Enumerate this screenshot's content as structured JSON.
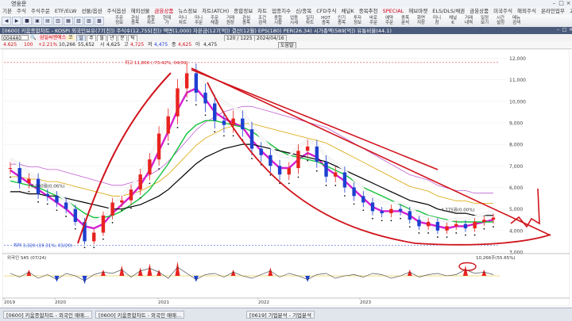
{
  "app": {
    "title": "영웅문"
  },
  "menubar": [
    "기본",
    "주식",
    "주식주문",
    "ETF/ELW",
    "선물/옵션",
    "주식옵션",
    "해외선물",
    "금융상품",
    "뉴스정보",
    "차트(ATCH)",
    "종합정보",
    "차트",
    "업종지수",
    "신/종목",
    "CFD주식",
    "채널K",
    "종목추천",
    "SPECIAL",
    "헤브마켓",
    "ELS/DLS/채권",
    "금융상품",
    "미국주식",
    "해외주식",
    "온라인업무",
    "고객서비스",
    "보기"
  ],
  "menubar_highlight": [
    7,
    17
  ],
  "toolbar": {
    "left_buttons": [
      "◀",
      "▶",
      "■",
      "▣",
      "▤",
      "▥",
      "▦",
      "▧",
      "▨",
      "▩"
    ],
    "tools": [
      {
        "l1": "주문",
        "l2": "정보"
      },
      {
        "l1": "관심",
        "l2": "종목"
      },
      {
        "l1": "종합",
        "l2": "차트"
      },
      {
        "l1": "현재",
        "l2": "가"
      },
      {
        "l1": "미니",
        "l2": "차트"
      },
      {
        "l1": "미니",
        "l2": "주문"
      },
      {
        "l1": "주문",
        "l2": "체결"
      },
      {
        "l1": "거래",
        "l2": "원장"
      },
      {
        "l1": "관심",
        "l2": "종목"
      },
      {
        "l1": "조건",
        "l2": "검색"
      },
      {
        "l1": "종합",
        "l2": "시황"
      },
      {
        "l1": "업종",
        "l2": "시세"
      },
      {
        "l1": "일지",
        "l2": "차트"
      },
      {
        "l1": "HOT",
        "l2": "종목"
      },
      {
        "l1": "인기",
        "l2": "종목"
      },
      {
        "l1": "투자",
        "l2": "정보"
      },
      {
        "l1": "바로",
        "l2": "주문"
      },
      {
        "l1": "예약",
        "l2": "주문"
      },
      {
        "l1": "종목",
        "l2": "분석"
      },
      {
        "l1": "화면",
        "l2": "저장"
      },
      {
        "l1": "미니",
        "l2": "창"
      },
      {
        "l1": "채널",
        "l2": "K"
      },
      {
        "l1": "거래",
        "l2": "내역"
      },
      {
        "l1": "일정",
        "l2": "보기"
      },
      {
        "l1": "시간",
        "l2": "설정"
      },
      {
        "l1": "메뉴",
        "l2": "검색"
      }
    ]
  },
  "window_tab": {
    "title": "[0600] 키움종합차트 - KOSPI 외국인보유(77[천]) 주식수(12,755[천]) 액면(1,000) 자본금(127[억]) 결산(12월) EPS(180) PER(26.34) 시가총액(589[억]) 유통비율(44.1)"
  },
  "search": {
    "code": "004440",
    "name": "삼일씨엔에스",
    "kospi_badge": "코",
    "period_buttons": [
      "일",
      "주",
      "월",
      "년",
      "분",
      "틱"
    ],
    "range": "120 / 1225",
    "date": "2024/04/16"
  },
  "price_row": {
    "price": "4.625",
    "change_label": "100",
    "change_pct": "+2.21%",
    "volume_k": "10,266",
    "amount": "55,652",
    "open_lbl": "시",
    "open": "4,625",
    "high_lbl": "고",
    "high": "4,725",
    "low_lbl": "저",
    "low": "4,475",
    "close_lbl": "종",
    "close": "4,625",
    "flag": "아",
    "ma": "4,475",
    "menu": "도움말"
  },
  "chart_data": {
    "type": "candlestick",
    "x_years": [
      "2019",
      "2020",
      "2021",
      "2022",
      "2023"
    ],
    "y_range": [
      3320,
      11800
    ],
    "price_annotations": {
      "high": "최고 11,800 (-73.42%, 04/09)",
      "low": "최저 3,320 (19.31%, 03/20)",
      "mid_left": "6,080원(0.06%)",
      "mid_right": "4,775원(0.00%)"
    },
    "right_labels": [
      "12,000",
      "11,000",
      "10,000",
      "9,000",
      "8,000",
      "7,000",
      "6,000",
      "5,000",
      "4,000",
      "3,000"
    ],
    "series": [
      {
        "name": "close",
        "values": [
          6.9,
          6.2,
          6.4,
          5.7,
          5.6,
          5.3,
          5.0,
          4.4,
          3.5,
          3.9,
          4.7,
          5.3,
          5.4,
          5.9,
          6.6,
          7.3,
          8.5,
          9.3,
          10.6,
          11.3,
          10.4,
          9.9,
          9.1,
          8.9,
          9.2,
          8.7,
          7.8,
          7.5,
          7.0,
          6.6,
          6.9,
          7.7,
          7.9,
          7.2,
          6.5,
          6.7,
          6.0,
          5.6,
          5.3,
          4.9,
          4.8,
          5.0,
          4.9,
          4.5,
          4.2,
          4.4,
          4.0,
          4.2,
          4.3,
          4.1,
          4.4,
          4.5,
          4.6
        ]
      },
      {
        "name": "ma5",
        "values": [
          6.8,
          6.5,
          6.2,
          5.9,
          5.6,
          5.3,
          5.0,
          4.6,
          4.2,
          4.1,
          4.3,
          4.8,
          5.2,
          5.6,
          6.1,
          6.8,
          7.7,
          8.6,
          9.6,
          10.4,
          10.6,
          10.1,
          9.5,
          9.2,
          9.0,
          8.8,
          8.2,
          7.7,
          7.3,
          6.9,
          6.9,
          7.3,
          7.6,
          7.4,
          6.9,
          6.6,
          6.3,
          5.9,
          5.5,
          5.1,
          4.9,
          4.9,
          4.9,
          4.7,
          4.4,
          4.3,
          4.2,
          4.1,
          4.2,
          4.2,
          4.3,
          4.4,
          4.5
        ]
      },
      {
        "name": "ma20",
        "values": [
          6.3,
          6.2,
          6.1,
          6.0,
          5.8,
          5.6,
          5.4,
          5.1,
          4.8,
          4.6,
          4.6,
          4.7,
          4.9,
          5.2,
          5.5,
          5.9,
          6.5,
          7.1,
          7.8,
          8.5,
          8.9,
          9.1,
          9.1,
          9.0,
          8.9,
          8.8,
          8.6,
          8.3,
          8.0,
          7.7,
          7.5,
          7.4,
          7.3,
          7.2,
          7.0,
          6.8,
          6.6,
          6.3,
          6.0,
          5.8,
          5.6,
          5.4,
          5.2,
          5.0,
          4.9,
          4.7,
          4.6,
          4.5,
          4.4,
          4.4,
          4.4,
          4.4,
          4.4
        ]
      },
      {
        "name": "ma120",
        "values": [
          5.8,
          5.8,
          5.7,
          5.7,
          5.6,
          5.6,
          5.5,
          5.4,
          5.3,
          5.2,
          5.1,
          5.0,
          5.0,
          5.1,
          5.2,
          5.4,
          5.6,
          5.9,
          6.3,
          6.7,
          7.1,
          7.4,
          7.6,
          7.8,
          7.9,
          8.0,
          8.0,
          7.9,
          7.8,
          7.7,
          7.6,
          7.5,
          7.4,
          7.3,
          7.2,
          7.0,
          6.8,
          6.6,
          6.4,
          6.2,
          6.0,
          5.8,
          5.6,
          5.4,
          5.3,
          5.2,
          5.0,
          4.9,
          4.8,
          4.8,
          4.7,
          4.7,
          4.7
        ]
      }
    ],
    "sub_pane": {
      "label": "외국인 S45 (07/24)",
      "right": "10,266주(55.65%)",
      "values": [
        2,
        -1,
        3,
        -2,
        1,
        -3,
        2,
        0,
        -4,
        1,
        3,
        2,
        5,
        -1,
        4,
        6,
        3,
        -2,
        7,
        2,
        -3,
        1,
        2,
        -1,
        3,
        0,
        -2,
        1,
        4,
        -1,
        2,
        0,
        -3,
        1,
        2,
        -2,
        0,
        1,
        -1,
        2,
        1,
        -2,
        0,
        3,
        -1,
        1,
        2,
        0,
        1,
        5,
        2,
        3,
        1
      ]
    }
  },
  "taskbar": [
    {
      "label": "[0600] 키움종합차트 - 외국인 매매..."
    },
    {
      "label": "[0600] 키움종합차트 - 외국인 매매..."
    },
    {
      "label": "[0619] 기업분석 - 기업분석"
    }
  ],
  "colors": {
    "up": "#e8231f",
    "down": "#1d3fd0",
    "ma5": "#d41fd0",
    "ma20": "#12c23a",
    "ma120": "#000000",
    "ma240": "#d9a400",
    "env_upper": "#ffffff",
    "annotation": "#d0141c",
    "bg": "#ffffff"
  }
}
